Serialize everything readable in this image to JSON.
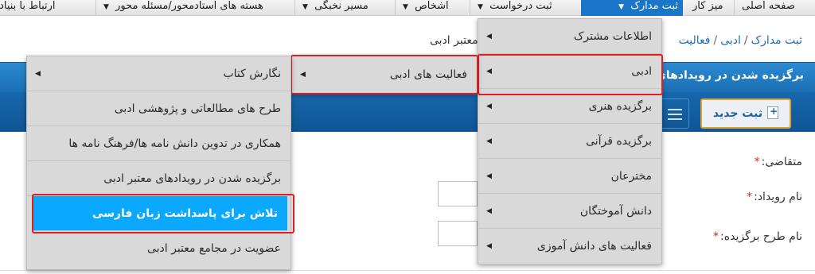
{
  "topnav": {
    "items": [
      {
        "label": "صفحه اصلی"
      },
      {
        "label": "میز کار"
      },
      {
        "label": "ثبت مدارک"
      },
      {
        "label": "ثبت درخواست"
      },
      {
        "label": "اشخاص"
      },
      {
        "label": "مسیر نخبگی"
      },
      {
        "label": "هسته های استادمحور/مسئله محور"
      },
      {
        "label": "ارتباط با بنیاد"
      }
    ]
  },
  "breadcrumb": {
    "items": [
      "ثبت مدارک",
      "ادبی",
      "فعالیت"
    ],
    "current": "های معتبر ادبی"
  },
  "panel": {
    "title": "برگزیده شدن در رویدادهای"
  },
  "toolbar": {
    "new_label": "ثبت جدید"
  },
  "form": {
    "applicant_label": "متقاضی:",
    "event_name_label": "نام رویداد:",
    "plan_name_label": "نام طرح برگزیده:",
    "required_mark": "*"
  },
  "menus": {
    "level1": [
      {
        "label": "اطلاعات مشترک"
      },
      {
        "label": "ادبی"
      },
      {
        "label": "برگزیده هنری"
      },
      {
        "label": "برگزیده قرآنی"
      },
      {
        "label": "مخترعان"
      },
      {
        "label": "دانش آموختگان"
      },
      {
        "label": "فعالیت های دانش آموزی"
      }
    ],
    "level2": [
      {
        "label": "فعالیت های ادبی"
      }
    ],
    "level3": [
      {
        "label": "نگارش کتاب"
      },
      {
        "label": "طرح های مطالعاتی و پژوهشی ادبی"
      },
      {
        "label": "همکاری در تدوین دانش نامه ها/فرهنگ نامه ها"
      },
      {
        "label": "برگزیده شدن در رویدادهای معتبر ادبی"
      },
      {
        "label": "تلاش برای پاسداشت زبان فارسی"
      },
      {
        "label": "عضویت در مجامع معتبر ادبی"
      }
    ]
  },
  "colors": {
    "nav_active": "#1a76c8",
    "panel_header": "#1b6fb4",
    "menu_highlight": "#0aa9ff",
    "annotation_outline": "#e02020",
    "required": "#d9261c"
  },
  "icons": {
    "caret": "caret-down-icon",
    "submenu": "caret-left-icon",
    "new": "add-document-icon",
    "list": "list-icon"
  }
}
